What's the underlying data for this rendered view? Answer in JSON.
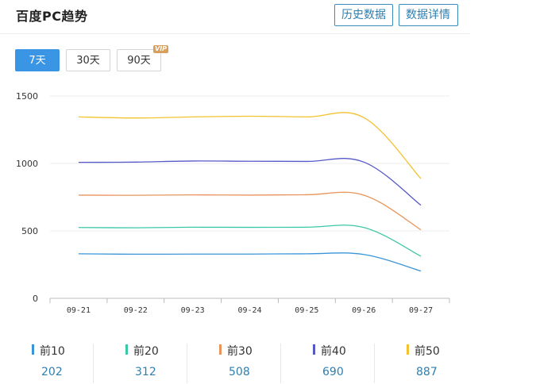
{
  "header": {
    "title": "百度PC趋势",
    "history_label": "历史数据",
    "detail_label": "数据详情"
  },
  "range_buttons": [
    {
      "label": "7天",
      "active": true
    },
    {
      "label": "30天",
      "active": false
    },
    {
      "label": "90天",
      "active": false,
      "badge": "VIP"
    }
  ],
  "colors": {
    "accent": "#3b95e5",
    "link": "#2f7fae",
    "vip": "#d9a05b"
  },
  "chart_data": {
    "type": "line",
    "categories": [
      "09-21",
      "09-22",
      "09-23",
      "09-24",
      "09-25",
      "09-26",
      "09-27"
    ],
    "ylim": [
      0,
      1500
    ],
    "yticks": [
      0,
      500,
      1000,
      1500
    ],
    "grid": true,
    "series": [
      {
        "name": "前10",
        "color": "#3a95d8",
        "values": [
          330,
          327,
          328,
          328,
          330,
          325,
          202
        ]
      },
      {
        "name": "前20",
        "color": "#3cc8a8",
        "values": [
          525,
          523,
          527,
          526,
          527,
          525,
          312
        ]
      },
      {
        "name": "前30",
        "color": "#e8945a",
        "values": [
          765,
          764,
          767,
          765,
          768,
          765,
          508
        ]
      },
      {
        "name": "前40",
        "color": "#5558c8",
        "values": [
          1008,
          1010,
          1018,
          1016,
          1015,
          1010,
          690
        ]
      },
      {
        "name": "前50",
        "color": "#f2c230",
        "values": [
          1345,
          1337,
          1345,
          1350,
          1345,
          1340,
          887
        ]
      }
    ]
  },
  "legend": [
    {
      "label": "前10",
      "value": "202",
      "color": "#3a95d8"
    },
    {
      "label": "前20",
      "value": "312",
      "color": "#3cc8a8"
    },
    {
      "label": "前30",
      "value": "508",
      "color": "#e8945a"
    },
    {
      "label": "前40",
      "value": "690",
      "color": "#5558c8"
    },
    {
      "label": "前50",
      "value": "887",
      "color": "#f2c230"
    }
  ]
}
